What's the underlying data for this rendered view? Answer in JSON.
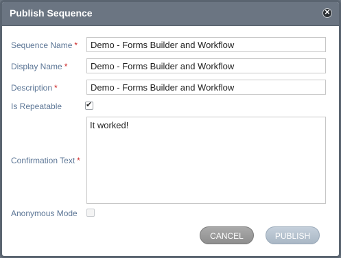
{
  "dialog": {
    "title": "Publish Sequence",
    "close_icon": "close-icon"
  },
  "form": {
    "sequence_name": {
      "label": "Sequence Name",
      "required": "*",
      "value": "Demo - Forms Builder and Workflow"
    },
    "display_name": {
      "label": "Display Name",
      "required": "*",
      "value": "Demo - Forms Builder and Workflow"
    },
    "description": {
      "label": "Description",
      "required": "*",
      "value": "Demo - Forms Builder and Workflow"
    },
    "is_repeatable": {
      "label": "Is Repeatable",
      "checked": true
    },
    "confirmation_text": {
      "label": "Confirmation Text",
      "required": "*",
      "value": "It worked!"
    },
    "anonymous_mode": {
      "label": "Anonymous Mode",
      "checked": false,
      "disabled": true
    }
  },
  "buttons": {
    "cancel_label": "CANCEL",
    "publish_label": "PUBLISH"
  }
}
